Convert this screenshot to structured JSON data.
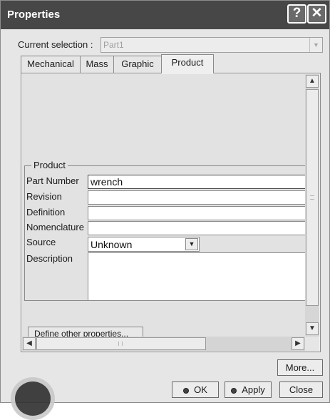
{
  "window": {
    "title": "Properties",
    "help_glyph": "?",
    "close_glyph": "✕"
  },
  "selection": {
    "label": "Current selection :",
    "value": "Part1"
  },
  "tabs": [
    {
      "label": "Mechanical",
      "active": false
    },
    {
      "label": "Mass",
      "active": false
    },
    {
      "label": "Graphic",
      "active": false
    },
    {
      "label": "Product",
      "active": true
    }
  ],
  "product_group": {
    "title": "Product",
    "fields": {
      "part_number": {
        "label": "Part Number",
        "value": "wrench"
      },
      "revision": {
        "label": "Revision",
        "value": ""
      },
      "definition": {
        "label": "Definition",
        "value": ""
      },
      "nomenclature": {
        "label": "Nomenclature",
        "value": ""
      },
      "source": {
        "label": "Source",
        "value": "Unknown"
      },
      "description": {
        "label": "Description",
        "value": ""
      }
    }
  },
  "define_button": {
    "label": "Define other properties..."
  },
  "buttons": {
    "more": "More...",
    "ok": "OK",
    "apply": "Apply",
    "close": "Close"
  },
  "colors": {
    "titlebar": "#474747",
    "dialog_bg": "#e6e6e6",
    "disabled_text": "#a0a0a0"
  }
}
